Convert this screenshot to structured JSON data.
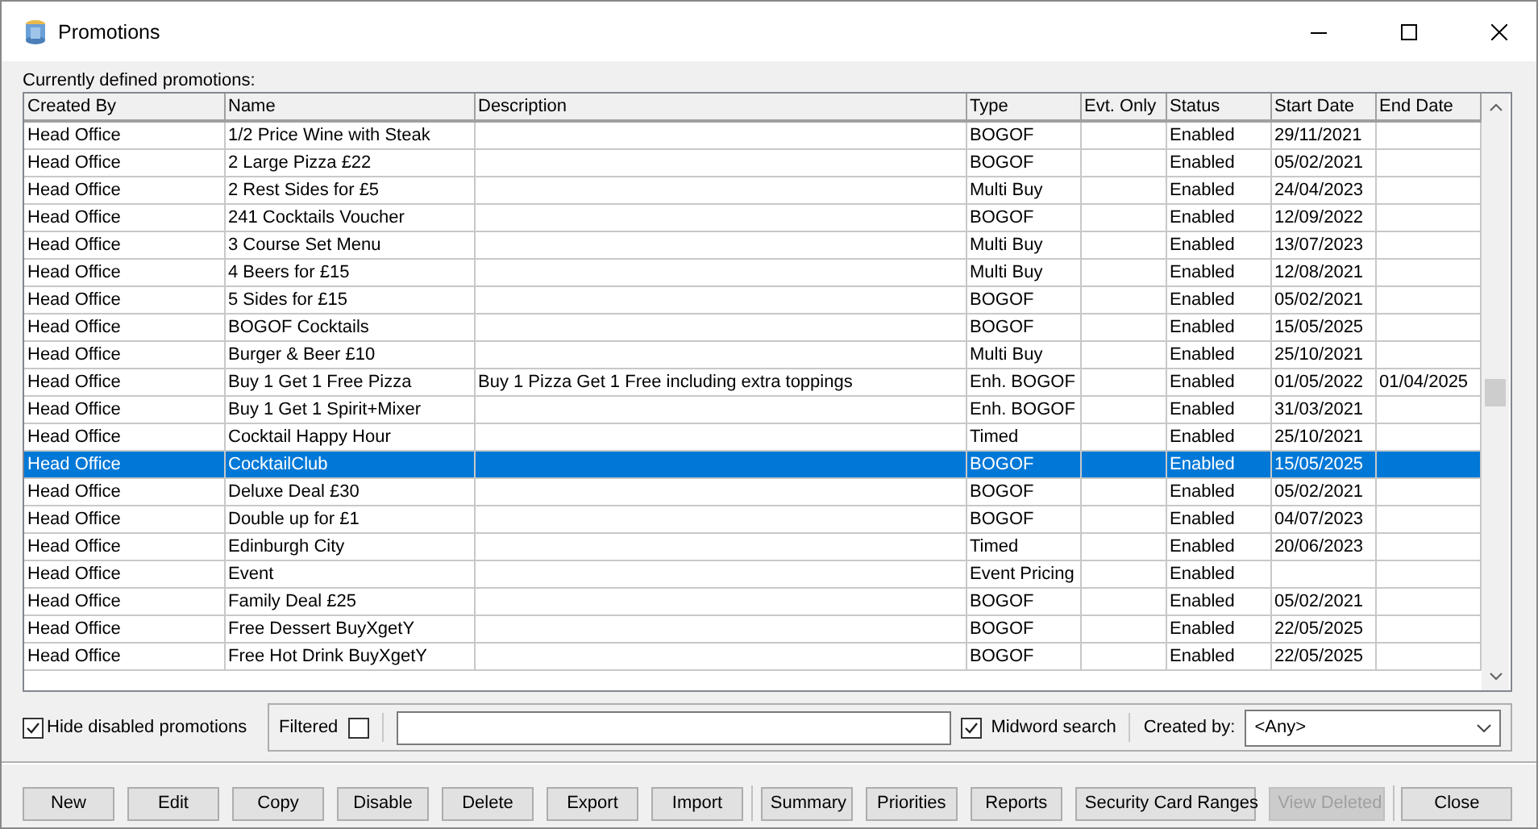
{
  "window": {
    "title": "Promotions"
  },
  "list_label": "Currently defined promotions:",
  "table": {
    "columns": [
      "Created By",
      "Name",
      "Description",
      "Type",
      "Evt. Only",
      "Status",
      "Start Date",
      "End Date"
    ],
    "rows": [
      {
        "created_by": "Head Office",
        "name": "1/2 Price Wine with Steak",
        "type": "BOGOF",
        "status": "Enabled",
        "start_date": "29/11/2021",
        "selected": false
      },
      {
        "created_by": "Head Office",
        "name": "2 Large Pizza £22",
        "type": "BOGOF",
        "status": "Enabled",
        "start_date": "05/02/2021",
        "selected": false
      },
      {
        "created_by": "Head Office",
        "name": "2 Rest Sides for £5",
        "type": "Multi Buy",
        "status": "Enabled",
        "start_date": "24/04/2023",
        "selected": false
      },
      {
        "created_by": "Head Office",
        "name": "241 Cocktails Voucher",
        "type": "BOGOF",
        "status": "Enabled",
        "start_date": "12/09/2022",
        "selected": false
      },
      {
        "created_by": "Head Office",
        "name": "3 Course Set Menu",
        "type": "Multi Buy",
        "status": "Enabled",
        "start_date": "13/07/2023",
        "selected": false
      },
      {
        "created_by": "Head Office",
        "name": "4 Beers for £15",
        "type": "Multi Buy",
        "status": "Enabled",
        "start_date": "12/08/2021",
        "selected": false
      },
      {
        "created_by": "Head Office",
        "name": "5 Sides for £15",
        "type": "BOGOF",
        "status": "Enabled",
        "start_date": "05/02/2021",
        "selected": false
      },
      {
        "created_by": "Head Office",
        "name": "BOGOF Cocktails",
        "type": "BOGOF",
        "status": "Enabled",
        "start_date": "15/05/2025",
        "selected": false
      },
      {
        "created_by": "Head Office",
        "name": "Burger & Beer £10",
        "type": "Multi Buy",
        "status": "Enabled",
        "start_date": "25/10/2021",
        "selected": false
      },
      {
        "created_by": "Head Office",
        "name": "Buy 1 Get 1 Free Pizza",
        "description": "Buy 1 Pizza Get 1 Free including extra toppings",
        "type": "Enh. BOGOF",
        "status": "Enabled",
        "start_date": "01/05/2022",
        "end_date": "01/04/2025",
        "selected": false
      },
      {
        "created_by": "Head Office",
        "name": "Buy 1 Get 1 Spirit+Mixer",
        "type": "Enh. BOGOF",
        "status": "Enabled",
        "start_date": "31/03/2021",
        "selected": false
      },
      {
        "created_by": "Head Office",
        "name": "Cocktail Happy Hour",
        "type": "Timed",
        "status": "Enabled",
        "start_date": "25/10/2021",
        "selected": false
      },
      {
        "created_by": "Head Office",
        "name": "CocktailClub",
        "type": "BOGOF",
        "status": "Enabled",
        "start_date": "15/05/2025",
        "selected": true
      },
      {
        "created_by": "Head Office",
        "name": "Deluxe Deal £30",
        "type": "BOGOF",
        "status": "Enabled",
        "start_date": "05/02/2021",
        "selected": false
      },
      {
        "created_by": "Head Office",
        "name": "Double up for £1",
        "type": "BOGOF",
        "status": "Enabled",
        "start_date": "04/07/2023",
        "selected": false
      },
      {
        "created_by": "Head Office",
        "name": "Edinburgh City",
        "type": "Timed",
        "status": "Enabled",
        "start_date": "20/06/2023",
        "selected": false
      },
      {
        "created_by": "Head Office",
        "name": "Event",
        "type": "Event Pricing",
        "status": "Enabled",
        "selected": false
      },
      {
        "created_by": "Head Office",
        "name": "Family Deal £25",
        "type": "BOGOF",
        "status": "Enabled",
        "start_date": "05/02/2021",
        "selected": false
      },
      {
        "created_by": "Head Office",
        "name": "Free Dessert BuyXgetY",
        "type": "BOGOF",
        "status": "Enabled",
        "start_date": "22/05/2025",
        "selected": false
      },
      {
        "created_by": "Head Office",
        "name": "Free Hot Drink BuyXgetY",
        "type": "BOGOF",
        "status": "Enabled",
        "start_date": "22/05/2025",
        "selected": false
      }
    ]
  },
  "filters": {
    "hide_disabled": {
      "label": "Hide disabled promotions",
      "checked": true
    },
    "filtered": {
      "label": "Filtered",
      "checked": false
    },
    "midword": {
      "label": "Midword search",
      "checked": true
    },
    "created_by": {
      "label": "Created by:",
      "value": "<Any>"
    }
  },
  "buttons": [
    {
      "label": "New",
      "disabled": false
    },
    {
      "label": "Edit",
      "disabled": false
    },
    {
      "label": "Copy",
      "disabled": false
    },
    {
      "label": "Disable",
      "disabled": false
    },
    {
      "label": "Delete",
      "disabled": false
    },
    {
      "label": "Export",
      "disabled": false
    },
    {
      "label": "Import",
      "disabled": false,
      "group_end": true
    },
    {
      "label": "Summary",
      "disabled": false
    },
    {
      "label": "Priorities",
      "disabled": false
    },
    {
      "label": "Reports",
      "disabled": false
    },
    {
      "label": "Security Card Ranges",
      "disabled": false
    },
    {
      "label": "View Deleted",
      "disabled": true,
      "group_end": true
    },
    {
      "label": "Close",
      "disabled": false
    }
  ]
}
